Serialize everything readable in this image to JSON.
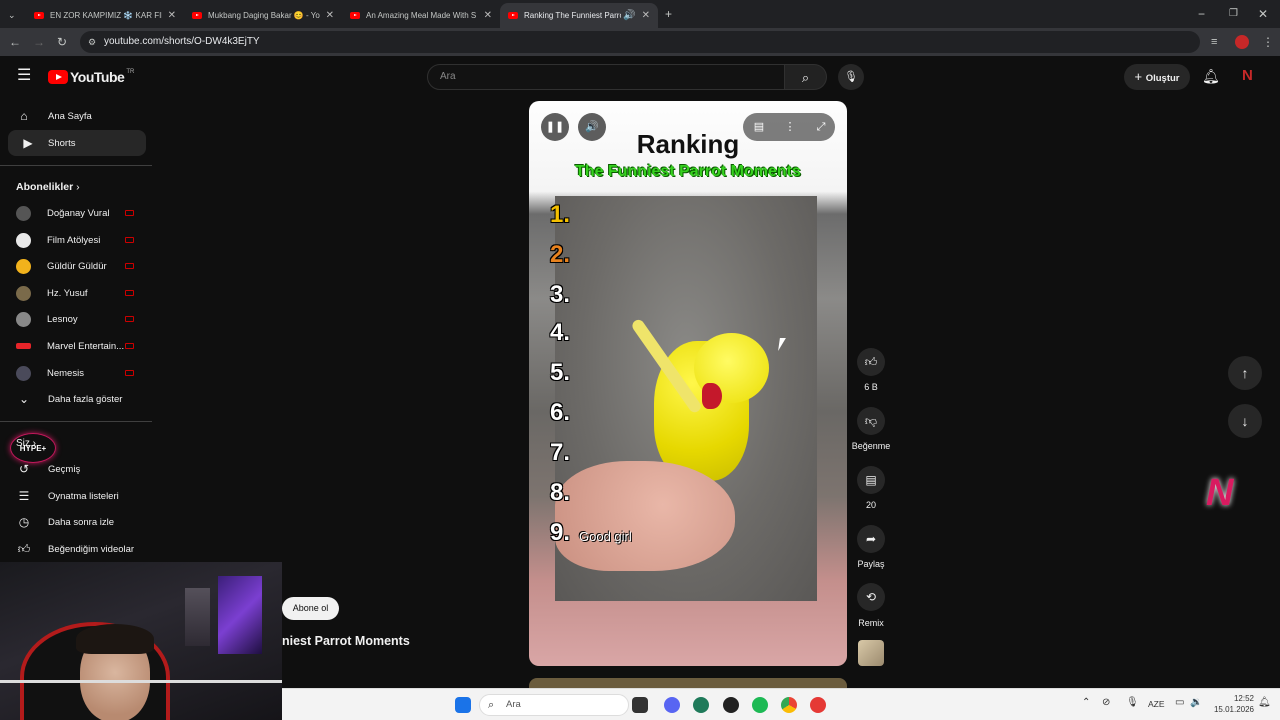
{
  "browser": {
    "tabs": [
      {
        "title": "EN ZOR KAMPIMIZ ❄️ KAR FIR"
      },
      {
        "title": "Mukbang Daging Bakar 😊 - Yo"
      },
      {
        "title": "An Amazing Meal Made With S"
      },
      {
        "title": "Ranking The Funniest Parrot"
      }
    ],
    "url": "youtube.com/shorts/O-DW4k3EjTY"
  },
  "youtube": {
    "logo_text": "YouTube",
    "region": "TR",
    "search_placeholder": "Ara",
    "create_label": "Oluştur"
  },
  "sidebar": {
    "main": [
      {
        "label": "Ana Sayfa",
        "icon": "home-icon"
      },
      {
        "label": "Shorts",
        "icon": "shorts-icon"
      }
    ],
    "subs_title": "Abonelikler",
    "subscriptions": [
      {
        "label": "Doğanay Vural",
        "color": "#555555"
      },
      {
        "label": "Film Atölyesi",
        "color": "#e8e8e8"
      },
      {
        "label": "Güldür Güldür",
        "color": "#f2b21c"
      },
      {
        "label": "Hz. Yusuf",
        "color": "#7a6a4a"
      },
      {
        "label": "Lesnoy",
        "color": "#888888"
      },
      {
        "label": "Marvel Entertain...",
        "color": "#e62429"
      },
      {
        "label": "Nemesis",
        "color": "#4a4a5a"
      }
    ],
    "show_more": "Daha fazla göster",
    "you_title": "Siz",
    "you_items": [
      {
        "label": "Geçmiş",
        "icon": "history-icon"
      },
      {
        "label": "Oynatma listeleri",
        "icon": "playlist-icon"
      },
      {
        "label": "Daha sonra izle",
        "icon": "watch-later-icon"
      },
      {
        "label": "Beğendiğim videolar",
        "icon": "liked-icon"
      }
    ]
  },
  "video": {
    "title": "Ranking",
    "subtitle": "The Funniest Parrot Moments",
    "ranks": [
      "1.",
      "2.",
      "3.",
      "4.",
      "5.",
      "6.",
      "7.",
      "8.",
      "9."
    ],
    "rank_colors": [
      "#f5c000",
      "#e8821e",
      "#ffffff",
      "#ffffff",
      "#ffffff",
      "#ffffff",
      "#ffffff",
      "#ffffff",
      "#ffffff"
    ],
    "caption": "Good girl",
    "channel_title": "niest Parrot Moments",
    "subscribe_label": "Abone ol"
  },
  "actions": {
    "like_count": "6 B",
    "dislike_label": "Beğenme",
    "comment_count": "20",
    "share_label": "Paylaş",
    "remix_label": "Remix"
  },
  "webcam_overlay": {
    "badge": "HYPE+"
  },
  "taskbar": {
    "search_placeholder": "Ara",
    "language": "AZE",
    "time": "12:52",
    "date": "15.01.2026"
  }
}
